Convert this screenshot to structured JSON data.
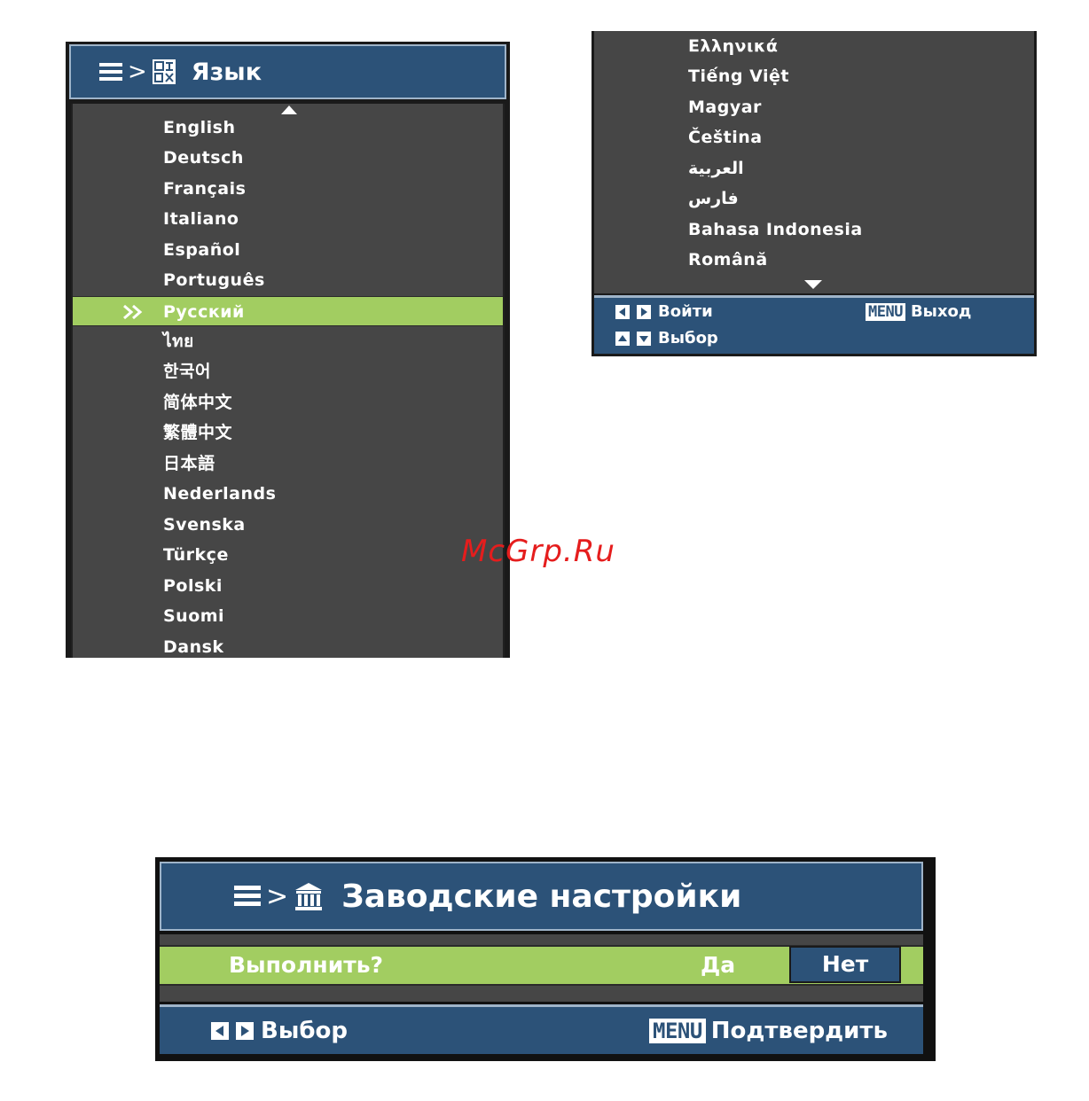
{
  "language_menu": {
    "title": "Язык",
    "separator": ">",
    "items": [
      "English",
      "Deutsch",
      "Français",
      "Italiano",
      "Español",
      "Português",
      "Русский",
      "ไทย",
      "한국어",
      "简体中文",
      "繁體中文",
      "日本語",
      "Nederlands",
      "Svenska",
      "Türkçe",
      "Polski",
      "Suomi",
      "Dansk"
    ],
    "selected_index": 6,
    "selected_marker": "»"
  },
  "language_menu_continued": {
    "items": [
      "Ελληνικά",
      "Tiếng Việt",
      "Magyar",
      "Čeština",
      "العربية",
      "فارس",
      "Bahasa Indonesia",
      "Română"
    ],
    "footer": {
      "enter_label": "Войти",
      "menu_key": "MENU",
      "exit_label": "Выход",
      "select_label": "Выбор"
    }
  },
  "watermark": "McGrp.Ru",
  "factory_reset": {
    "separator": ">",
    "title": "Заводские настройки",
    "question": "Выполнить?",
    "yes_label": "Да",
    "no_label": "Нет",
    "footer": {
      "select_label": "Выбор",
      "menu_key": "MENU",
      "confirm_label": "Подтвердить"
    }
  },
  "colors": {
    "header_blue": "#2c5278",
    "list_gray": "#464646",
    "highlight_green": "#a2cd61",
    "watermark_red": "#e51d1d"
  }
}
